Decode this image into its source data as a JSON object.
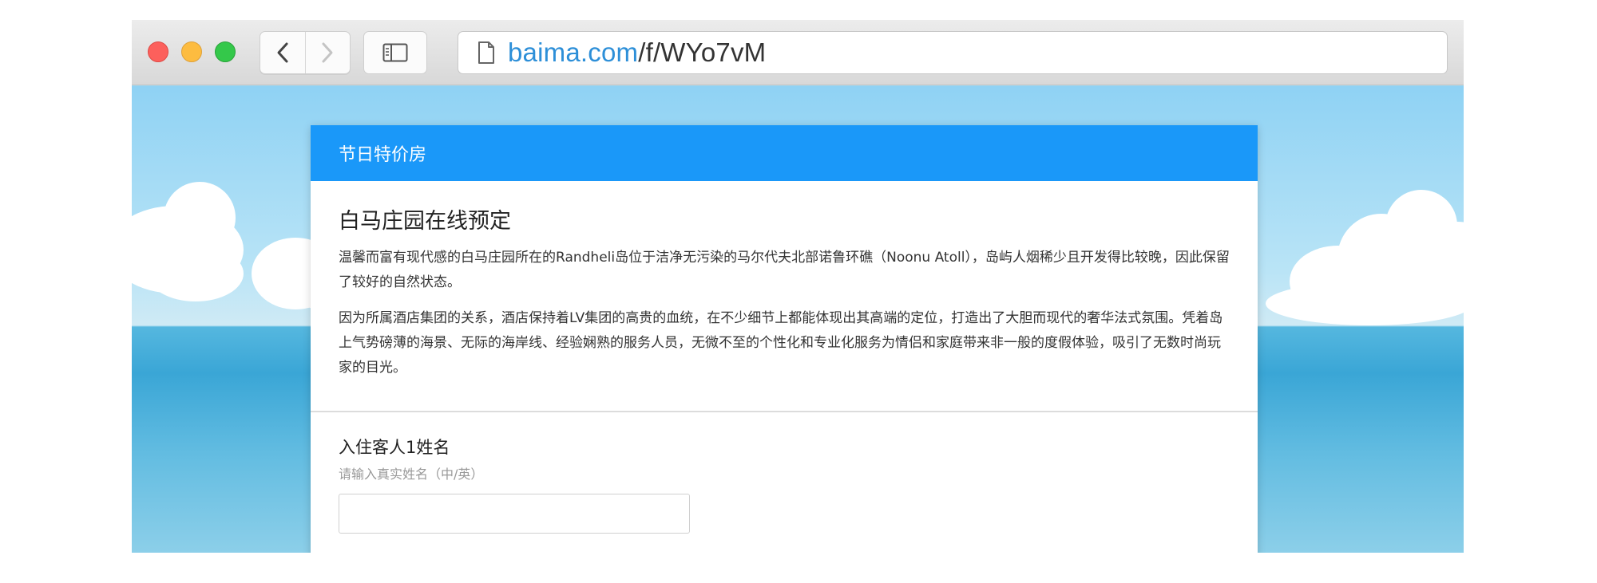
{
  "browser": {
    "url_domain": "baima.com",
    "url_path": "/f/WYo7vM",
    "icons": [
      "close-light",
      "minimize-light",
      "zoom-light",
      "back-chevron-icon",
      "forward-chevron-icon",
      "sidebar-icon",
      "page-icon"
    ]
  },
  "form": {
    "header": "节日特价房",
    "title": "白马庄园在线预定",
    "paragraphs": [
      "温馨而富有现代感的白马庄园所在的Randheli岛位于洁净无污染的马尔代夫北部诺鲁环礁（Noonu Atoll），岛屿人烟稀少且开发得比较晚，因此保留了较好的自然状态。",
      "因为所属酒店集团的关系，酒店保持着LV集团的高贵的血统，在不少细节上都能体现出其高端的定位，打造出了大胆而现代的奢华法式氛围。凭着岛上气势磅薄的海景、无际的海岸线、经验娴熟的服务人员，无微不至的个性化和专业化服务为情侣和家庭带来非一般的度假体验，吸引了无数时尚玩家的目光。"
    ],
    "fields": [
      {
        "label": "入住客人1姓名",
        "hint": "请输入真实姓名（中/英）",
        "value": ""
      }
    ]
  },
  "colors": {
    "accent": "#1a98f9",
    "url_domain": "#2d8fd8"
  }
}
